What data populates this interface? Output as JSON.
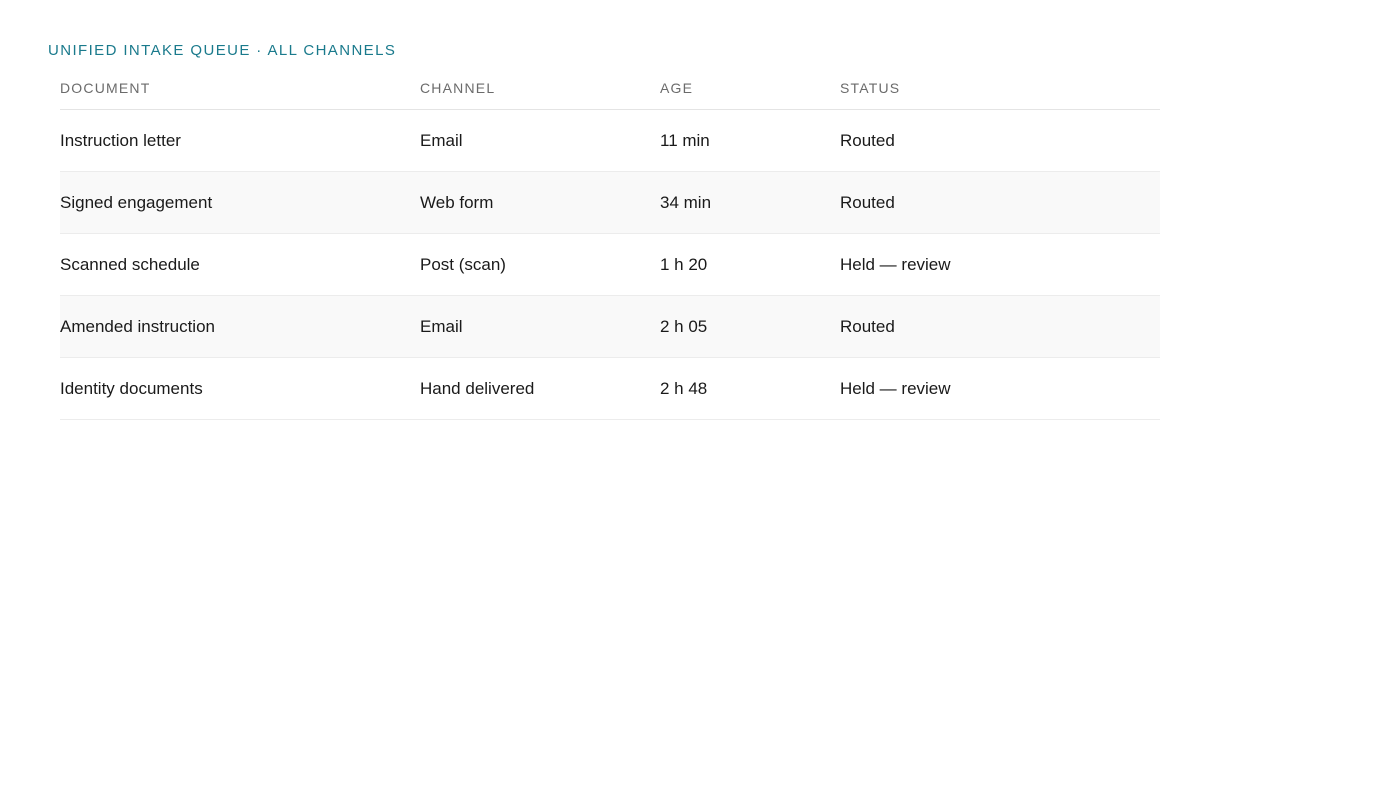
{
  "queue": {
    "title": "UNIFIED INTAKE QUEUE · ALL CHANNELS",
    "columns": {
      "document": "DOCUMENT",
      "channel": "CHANNEL",
      "age": "AGE",
      "status": "STATUS"
    },
    "rows": [
      {
        "document": "Instruction letter",
        "channel": "Email",
        "age": "11 min",
        "status": "Routed"
      },
      {
        "document": "Signed engagement",
        "channel": "Web form",
        "age": "34 min",
        "status": "Routed"
      },
      {
        "document": "Scanned schedule",
        "channel": "Post (scan)",
        "age": "1 h 20",
        "status": "Held — review"
      },
      {
        "document": "Amended instruction",
        "channel": "Email",
        "age": "2 h 05",
        "status": "Routed"
      },
      {
        "document": "Identity documents",
        "channel": "Hand delivered",
        "age": "2 h 48",
        "status": "Held — review"
      }
    ]
  }
}
